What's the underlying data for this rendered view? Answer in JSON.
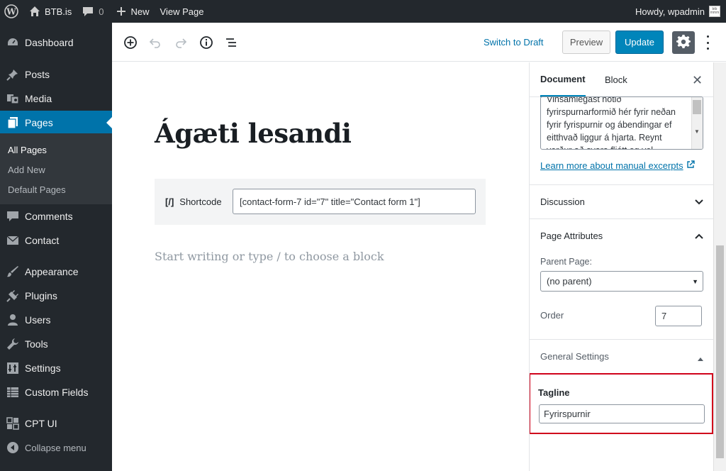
{
  "adminbar": {
    "site_name": "BTB.is",
    "comments_count": "0",
    "new_label": "New",
    "view_page_label": "View Page",
    "howdy": "Howdy, wpadmin"
  },
  "sidebar": {
    "items": [
      {
        "label": "Dashboard",
        "icon": "dashboard-icon"
      },
      {
        "label": "Posts",
        "icon": "pin-icon"
      },
      {
        "label": "Media",
        "icon": "media-icon"
      },
      {
        "label": "Pages",
        "icon": "pages-icon"
      },
      {
        "label": "Comments",
        "icon": "comment-icon"
      },
      {
        "label": "Contact",
        "icon": "mail-icon"
      },
      {
        "label": "Appearance",
        "icon": "brush-icon"
      },
      {
        "label": "Plugins",
        "icon": "plugin-icon"
      },
      {
        "label": "Users",
        "icon": "user-icon"
      },
      {
        "label": "Tools",
        "icon": "wrench-icon"
      },
      {
        "label": "Settings",
        "icon": "settings-icon"
      },
      {
        "label": "Custom Fields",
        "icon": "table-icon"
      },
      {
        "label": "CPT UI",
        "icon": "cpt-icon"
      }
    ],
    "submenu": [
      "All Pages",
      "Add New",
      "Default Pages"
    ],
    "collapse_label": "Collapse menu"
  },
  "toolbar": {
    "switch_to_draft": "Switch to Draft",
    "preview": "Preview",
    "update": "Update"
  },
  "editor": {
    "title": "Ágæti lesandi",
    "shortcode_icon": "[/]",
    "shortcode_label": "Shortcode",
    "shortcode_value": "[contact-form-7 id=\"7\" title=\"Contact form 1\"]",
    "placeholder": "Start writing or type / to choose a block"
  },
  "panel": {
    "tabs": [
      "Document",
      "Block"
    ],
    "excerpt_lines": [
      "Vinsamlegast notið",
      "fyrirspurnarformið hér fyrir neðan",
      "fyrir fyrispurnir og ábendingar ef",
      "eitthvað liggur á hjarta. Reynt",
      "verður að svara fljótt og vel."
    ],
    "learn_more": "Learn more about manual excerpts",
    "discussion": "Discussion",
    "page_attributes": "Page Attributes",
    "parent_label": "Parent Page:",
    "parent_value": "(no parent)",
    "order_label": "Order",
    "order_value": "7",
    "general_settings": "General Settings",
    "tagline_label": "Tagline",
    "tagline_value": "Fyrirspurnir"
  },
  "colors": {
    "admin_dark": "#23282d",
    "accent": "#0073aa",
    "update_button": "#0085ba",
    "highlight_border": "#d0021b"
  }
}
